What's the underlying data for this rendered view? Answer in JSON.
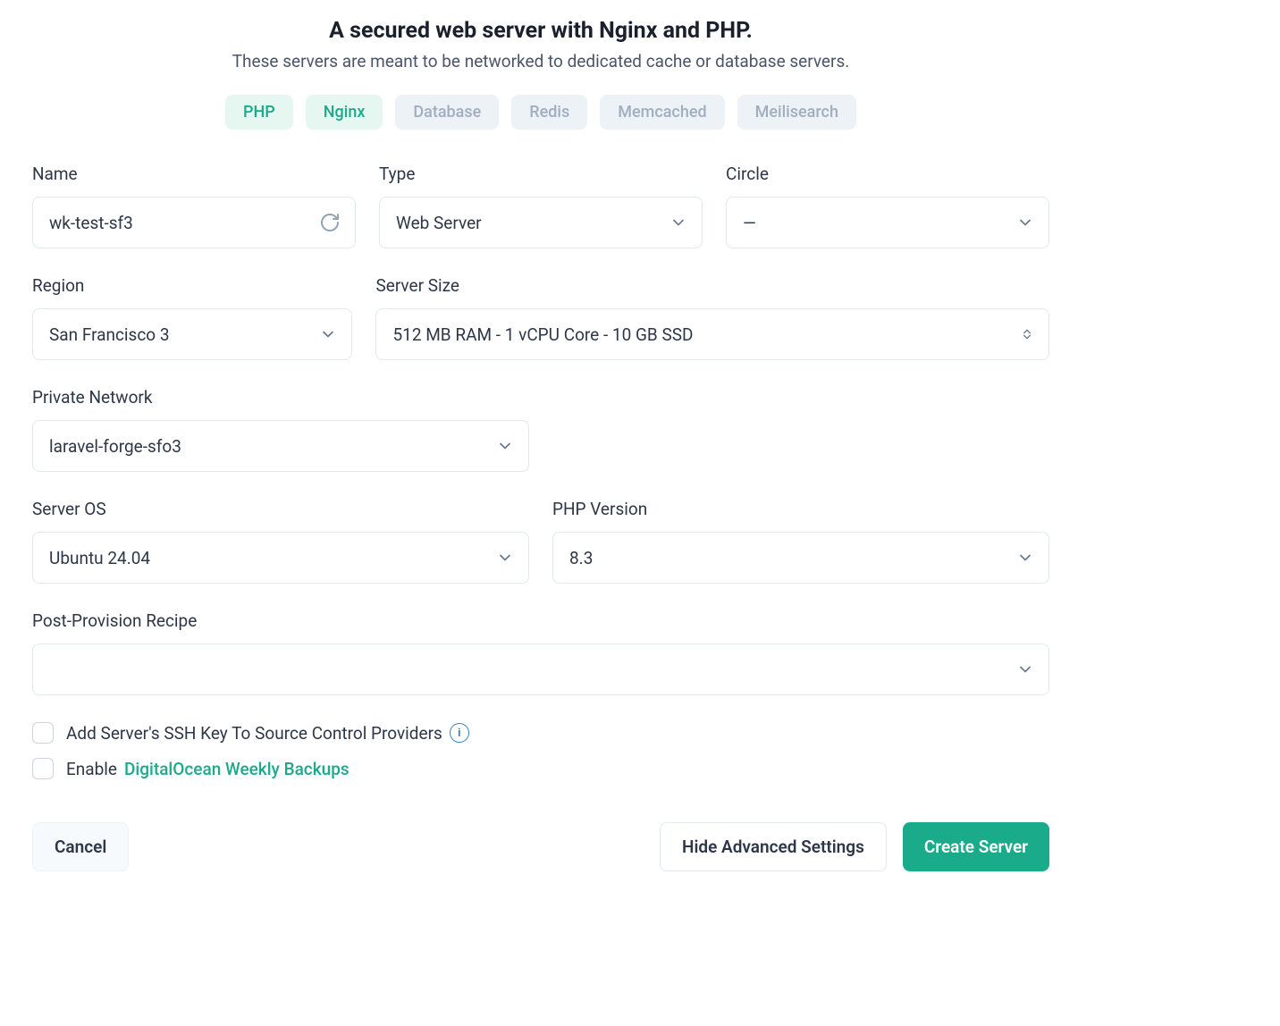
{
  "header": {
    "title": "A secured web server with Nginx and PHP.",
    "subtitle": "These servers are meant to be networked to dedicated cache or database servers."
  },
  "tags": {
    "php": "PHP",
    "nginx": "Nginx",
    "database": "Database",
    "redis": "Redis",
    "memcached": "Memcached",
    "meilisearch": "Meilisearch"
  },
  "labels": {
    "name": "Name",
    "type": "Type",
    "circle": "Circle",
    "region": "Region",
    "server_size": "Server Size",
    "private_network": "Private Network",
    "server_os": "Server OS",
    "php_version": "PHP Version",
    "post_provision": "Post-Provision Recipe"
  },
  "values": {
    "name": "wk-test-sf3",
    "type": "Web Server",
    "circle": "—",
    "region": "San Francisco 3",
    "server_size": "512 MB RAM - 1 vCPU Core - 10 GB SSD",
    "private_network": "laravel-forge-sfo3",
    "server_os": "Ubuntu 24.04",
    "php_version": "8.3",
    "post_provision": ""
  },
  "checkboxes": {
    "ssh_label": "Add Server's SSH Key To Source Control Providers",
    "backups_prefix": "Enable ",
    "backups_link": "DigitalOcean Weekly Backups"
  },
  "buttons": {
    "cancel": "Cancel",
    "hide_advanced": "Hide Advanced Settings",
    "create": "Create Server"
  }
}
